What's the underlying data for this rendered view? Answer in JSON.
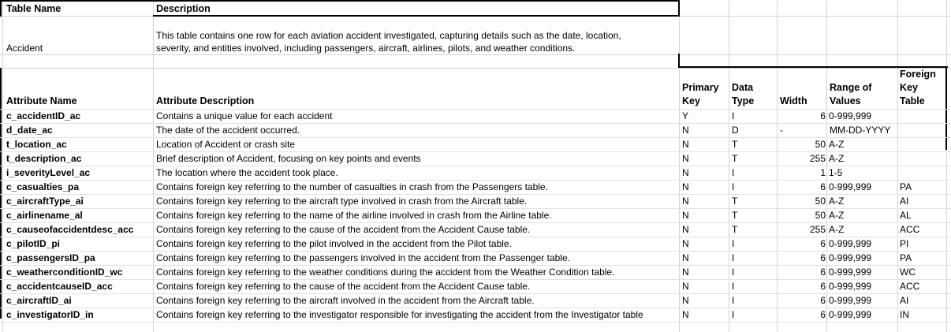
{
  "table_header": {
    "name_label": "Table Name",
    "description_label": "Description",
    "name_value": "Accident",
    "description_line1": "This table contains one row for each aviation accident investigated, capturing details such as the date, location,",
    "description_line2": "severity, and entities involved, including passengers, aircraft, airlines, pilots, and weather conditions."
  },
  "columns": {
    "attribute_name": "Attribute Name",
    "attribute_description": "Attribute Description",
    "primary_key_1": "Primary",
    "primary_key_2": "Key",
    "data_type_1": "Data",
    "data_type_2": "Type",
    "width": "Width",
    "range_1": "Range of",
    "range_2": "Values",
    "fk_1": "Foreign",
    "fk_2": "Key",
    "fk_3": "Table"
  },
  "rows": [
    {
      "name": "c_accidentID_ac",
      "desc": "Contains a unique value for each accident",
      "pk": "Y",
      "type": "I",
      "width": "6",
      "range": "0-999,999",
      "fk": ""
    },
    {
      "name": "d_date_ac",
      "desc": "The date of the accident occurred.",
      "pk": "N",
      "type": "D",
      "width": "-",
      "range": "MM-DD-YYYY",
      "fk": ""
    },
    {
      "name": "t_location_ac",
      "desc": "Location of Accident or crash site",
      "pk": "N",
      "type": "T",
      "width": "50",
      "range": "A-Z",
      "fk": ""
    },
    {
      "name": "t_description_ac",
      "desc": "Brief description of Accident, focusing on key points and events",
      "pk": "N",
      "type": "T",
      "width": "255",
      "range": "A-Z",
      "fk": ""
    },
    {
      "name": "i_severityLevel_ac",
      "desc": "The location where the accident took place.",
      "pk": "N",
      "type": "I",
      "width": "1",
      "range": "1-5",
      "fk": ""
    },
    {
      "name": "c_casualties_pa",
      "desc": "Contains foreign key referring to the number of casualties in crash from the Passengers table.",
      "pk": "N",
      "type": "I",
      "width": "6",
      "range": "0-999,999",
      "fk": "PA"
    },
    {
      "name": "c_aircraftType_ai",
      "desc": "Contains foreign key referring to the aircraft type involved in crash from the Aircraft table.",
      "pk": "N",
      "type": "T",
      "width": "50",
      "range": "A-Z",
      "fk": "AI"
    },
    {
      "name": "c_airlinename_al",
      "desc": "Contains foreign key referring to the name of the airline involved in crash from the Airline table.",
      "pk": "N",
      "type": "T",
      "width": "50",
      "range": "A-Z",
      "fk": "AL"
    },
    {
      "name": "c_causeofaccidentdesc_acc",
      "desc": "Contains foreign key referring to the cause of the accident from the Accident Cause table.",
      "pk": "N",
      "type": "T",
      "width": "255",
      "range": "A-Z",
      "fk": "ACC"
    },
    {
      "name": "c_pilotID_pi",
      "desc": "Contains foreign key referring to the pilot involved in the accident from the Pilot table.",
      "pk": "N",
      "type": "I",
      "width": "6",
      "range": "0-999,999",
      "fk": "PI"
    },
    {
      "name": "c_passengersID_pa",
      "desc": "Contains foreign key referring to the passengers involved in the accident from the Passenger table.",
      "pk": "N",
      "type": "I",
      "width": "6",
      "range": "0-999,999",
      "fk": "PA"
    },
    {
      "name": "c_weatherconditionID_wc",
      "desc": "Contains foreign key referring to the weather conditions during the accident from the Weather Condition table.",
      "pk": "N",
      "type": "I",
      "width": "6",
      "range": "0-999,999",
      "fk": "WC"
    },
    {
      "name": "c_accidentcauseID_acc",
      "desc": "Contains foreign key referring to the cause of the accident from the Accident Cause table.",
      "pk": "N",
      "type": "I",
      "width": "6",
      "range": "0-999,999",
      "fk": "ACC"
    },
    {
      "name": "c_aircraftID_ai",
      "desc": "Contains foreign key referring to the aircraft involved in the accident from the Aircraft table.",
      "pk": "N",
      "type": "I",
      "width": "6",
      "range": "0-999,999",
      "fk": "AI"
    },
    {
      "name": "c_investigatorID_in",
      "desc": "Contains foreign key referring to the investigator responsible for investigating the accident from the Investigator table",
      "pk": "N",
      "type": "I",
      "width": "6",
      "range": "0-999,999",
      "fk": "IN"
    }
  ]
}
